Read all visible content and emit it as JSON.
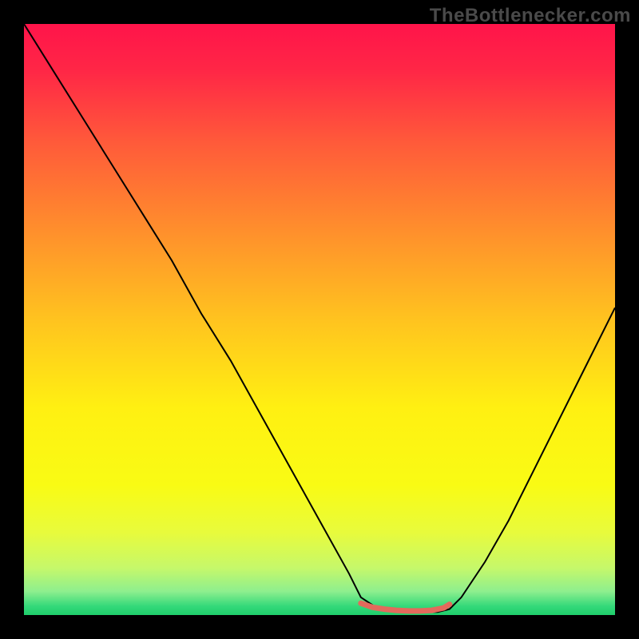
{
  "watermark": "TheBottlenecker.com",
  "chart_data": {
    "type": "line",
    "title": "",
    "xlabel": "",
    "ylabel": "",
    "xlim": [
      0,
      100
    ],
    "ylim": [
      0,
      100
    ],
    "background_gradient": {
      "stops": [
        {
          "pos": 0.0,
          "color": "#ff144a"
        },
        {
          "pos": 0.08,
          "color": "#ff2746"
        },
        {
          "pos": 0.2,
          "color": "#ff5a3a"
        },
        {
          "pos": 0.35,
          "color": "#ff8f2c"
        },
        {
          "pos": 0.5,
          "color": "#ffc31f"
        },
        {
          "pos": 0.65,
          "color": "#fff012"
        },
        {
          "pos": 0.78,
          "color": "#f9fb14"
        },
        {
          "pos": 0.86,
          "color": "#e8fb3c"
        },
        {
          "pos": 0.92,
          "color": "#c6f86a"
        },
        {
          "pos": 0.96,
          "color": "#8eef8e"
        },
        {
          "pos": 0.985,
          "color": "#34d97a"
        },
        {
          "pos": 1.0,
          "color": "#1fce6b"
        }
      ]
    },
    "series": [
      {
        "name": "curve",
        "color": "#000000",
        "width": 2,
        "x": [
          0,
          5,
          10,
          15,
          20,
          25,
          30,
          35,
          40,
          45,
          50,
          55,
          57,
          60,
          65,
          70,
          72,
          74,
          78,
          82,
          86,
          90,
          94,
          98,
          100
        ],
        "y": [
          100,
          92,
          84,
          76,
          68,
          60,
          51,
          43,
          34,
          25,
          16,
          7,
          3,
          1,
          0.5,
          0.5,
          1,
          3,
          9,
          16,
          24,
          32,
          40,
          48,
          52
        ]
      },
      {
        "name": "highlight-band",
        "color": "#e36a5c",
        "width": 7,
        "x": [
          57,
          59,
          61,
          63,
          65,
          67,
          69,
          71,
          72
        ],
        "y": [
          2.0,
          1.3,
          1.0,
          0.8,
          0.7,
          0.7,
          0.8,
          1.2,
          1.8
        ]
      }
    ]
  }
}
